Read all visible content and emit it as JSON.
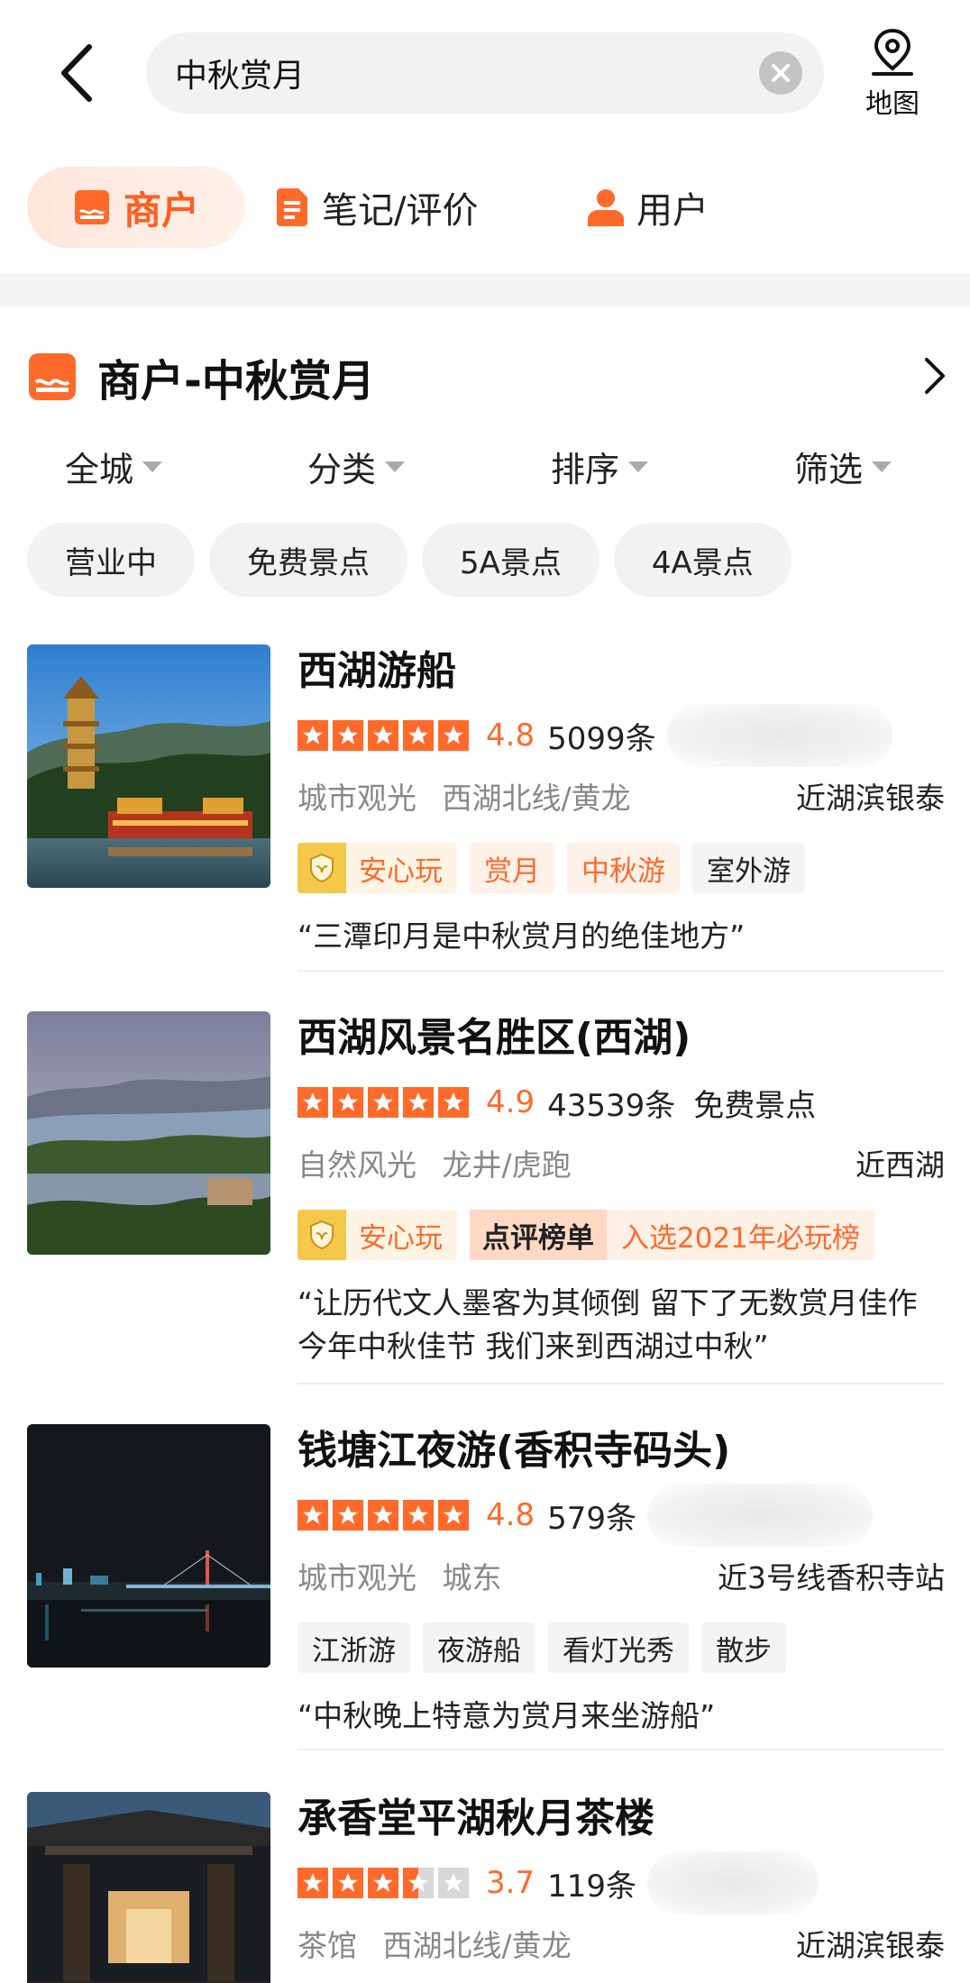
{
  "search": {
    "query": "中秋赏月"
  },
  "map_button": {
    "label": "地图"
  },
  "tabs": [
    {
      "label": "商户",
      "active": true
    },
    {
      "label": "笔记/评价",
      "active": false
    },
    {
      "label": "用户",
      "active": false
    }
  ],
  "section": {
    "title": "商户-中秋赏月"
  },
  "filters": [
    "全城",
    "分类",
    "排序",
    "筛选"
  ],
  "chips": [
    "营业中",
    "免费景点",
    "5A景点",
    "4A景点"
  ],
  "accent_color": "#ff6a2b",
  "listings": [
    {
      "name": "西湖游船",
      "rating": 4.8,
      "score": "4.8",
      "reviews": "5099条",
      "category": "城市观光",
      "area": "西湖北线/黄龙",
      "nearby": "近湖滨银泰",
      "safe_label": "安心玩",
      "tags": [
        "赏月",
        "中秋游",
        "室外游"
      ],
      "quote": "“三潭印月是中秋赏月的绝佳地方”"
    },
    {
      "name": "西湖风景名胜区(西湖)",
      "rating": 4.9,
      "score": "4.9",
      "reviews": "43539条",
      "extra": "免费景点",
      "category": "自然风光",
      "area": "龙井/虎跑",
      "nearby": "近西湖",
      "safe_label": "安心玩",
      "rank_label": "点评榜单",
      "rank_text": "入选2021年必玩榜",
      "quote": "“让历代文人墨客为其倾倒 留下了无数赏月佳作 今年中秋佳节 我们来到西湖过中秋”"
    },
    {
      "name": "钱塘江夜游(香积寺码头)",
      "rating": 4.8,
      "score": "4.8",
      "reviews": "579条",
      "category": "城市观光",
      "area": "城东",
      "nearby": "近3号线香积寺站",
      "tags": [
        "江浙游",
        "夜游船",
        "看灯光秀",
        "散步"
      ],
      "quote": "“中秋晚上特意为赏月来坐游船”"
    },
    {
      "name": "承香堂平湖秋月茶楼",
      "rating": 3.7,
      "score": "3.7",
      "reviews": "119条",
      "category": "茶馆",
      "area": "西湖北线/黄龙",
      "nearby": "近湖滨银泰"
    }
  ]
}
